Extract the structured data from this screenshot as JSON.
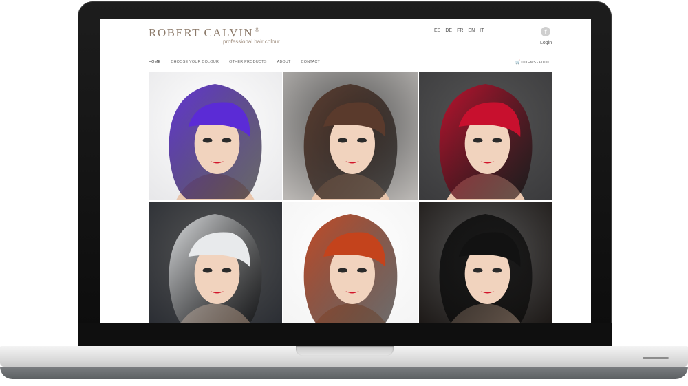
{
  "site": {
    "logo_name": "ROBERT CALVIN",
    "logo_mark": "®",
    "tagline": "professional hair colour"
  },
  "languages": [
    "ES",
    "DE",
    "FR",
    "EN",
    "IT"
  ],
  "social": {
    "facebook_glyph": "f"
  },
  "account": {
    "login_label": "Login"
  },
  "nav": {
    "items": [
      "HOME",
      "CHOOSE YOUR COLOUR",
      "OTHER PRODUCTS",
      "ABOUT",
      "CONTACT"
    ]
  },
  "cart": {
    "label": "0 ITEMS - £0.00"
  },
  "gallery": {
    "tiles": [
      {
        "hair": "#5b2bd6",
        "bg": "#e8e8ea"
      },
      {
        "hair": "#5a3a2c",
        "bg": "#b9b6b3"
      },
      {
        "hair": "#c8102e",
        "bg": "#3b3b3d"
      },
      {
        "hair": "#e8eaec",
        "bg": "#2a2d33"
      },
      {
        "hair": "#c4431c",
        "bg": "#f4f4f4"
      },
      {
        "hair": "#121212",
        "bg": "#1c1816"
      }
    ]
  },
  "colors": {
    "logo": "#8c7a6a",
    "laptop_frame": "#111111",
    "accent_lips": "#d2142a"
  }
}
